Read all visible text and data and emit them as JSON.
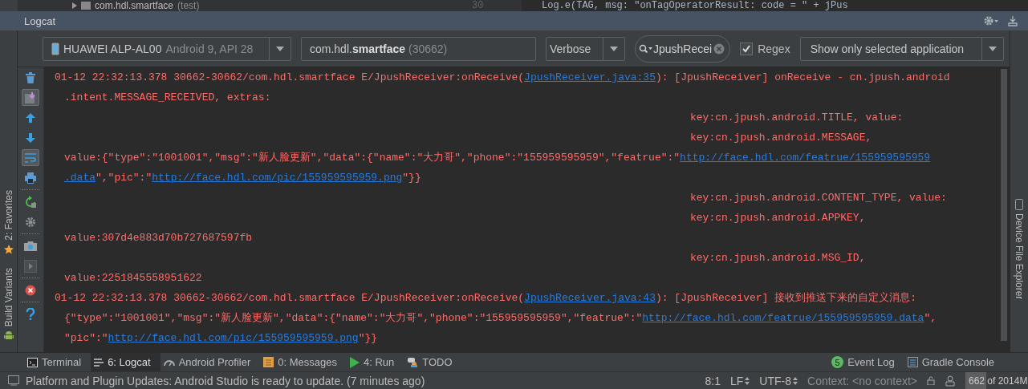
{
  "editor": {
    "project_node": "com.hdl.smartface",
    "project_suffix": "(test)",
    "line_number": "30",
    "code": "Log.e(TAG, msg: \"onTagOperatorResult: code = \" + jPus"
  },
  "logcat": {
    "title": "Logcat",
    "device": {
      "name": "HUAWEI ALP-AL00",
      "detail": "Android 9, API 28"
    },
    "process": {
      "prefix": "com.hdl.",
      "bold": "smartface",
      "pid": "(30662)"
    },
    "level": "Verbose",
    "search": {
      "value": "JpushRecei"
    },
    "regex": {
      "label": "Regex",
      "checked": true
    },
    "filter": "Show only selected application",
    "tools": [
      {
        "kind": "trash",
        "on": false
      },
      {
        "kind": "scroll-end",
        "on": true
      },
      {
        "kind": "up",
        "on": false
      },
      {
        "kind": "down",
        "on": false
      },
      {
        "kind": "wrap",
        "on": true
      },
      {
        "kind": "print",
        "on": false
      },
      {
        "kind": "restart",
        "on": false
      },
      {
        "kind": "gear",
        "on": false
      },
      {
        "kind": "camera",
        "on": false
      },
      {
        "kind": "video",
        "on": false
      },
      {
        "kind": "stop",
        "on": false
      },
      {
        "kind": "help",
        "on": false
      }
    ],
    "lines": [
      {
        "kind": "first",
        "segments": [
          {
            "text": "01-12 22:32:13.378 30662-30662/com.hdl.smartface E/JpushReceiver:onReceive(",
            "link": false
          },
          {
            "text": "JpushReceiver.java:35",
            "link": true
          },
          {
            "text": "): [JpushReceiver] onReceive - cn.jpush.android",
            "link": false
          }
        ]
      },
      {
        "kind": "cont",
        "segments": [
          {
            "text": ".intent.MESSAGE_RECEIVED, extras:",
            "link": false
          }
        ]
      },
      {
        "kind": "key",
        "segments": [
          {
            "text": "key:cn.jpush.android.TITLE, value:",
            "link": false
          }
        ]
      },
      {
        "kind": "key",
        "segments": [
          {
            "text": "key:cn.jpush.android.MESSAGE,",
            "link": false
          }
        ]
      },
      {
        "kind": "cont",
        "segments": [
          {
            "text": "value:{\"type\":\"1001001\",\"msg\":\"新人脸更新\",\"data\":{\"name\":\"大力哥\",\"phone\":\"155959595959\",\"featrue\":\"",
            "link": false
          },
          {
            "text": "http://face.hdl.com/featrue/155959595959",
            "link": true
          }
        ]
      },
      {
        "kind": "cont",
        "segments": [
          {
            "text": ".data",
            "link": true
          },
          {
            "text": "\",\"pic\":\"",
            "link": false
          },
          {
            "text": "http://face.hdl.com/pic/155959595959.png",
            "link": true
          },
          {
            "text": "\"}}",
            "link": false
          }
        ]
      },
      {
        "kind": "key",
        "segments": [
          {
            "text": "key:cn.jpush.android.CONTENT_TYPE, value:",
            "link": false
          }
        ]
      },
      {
        "kind": "key",
        "segments": [
          {
            "text": "key:cn.jpush.android.APPKEY,",
            "link": false
          }
        ]
      },
      {
        "kind": "cont",
        "segments": [
          {
            "text": "value:307d4e883d70b727687597fb",
            "link": false
          }
        ]
      },
      {
        "kind": "key",
        "segments": [
          {
            "text": "key:cn.jpush.android.MSG_ID,",
            "link": false
          }
        ]
      },
      {
        "kind": "cont",
        "segments": [
          {
            "text": "value:2251845558951622",
            "link": false
          }
        ]
      },
      {
        "kind": "first",
        "segments": [
          {
            "text": "01-12 22:32:13.378 30662-30662/com.hdl.smartface E/JpushReceiver:onReceive(",
            "link": false
          },
          {
            "text": "JpushReceiver.java:43",
            "link": true
          },
          {
            "text": "): [JpushReceiver] 接收到推送下来的自定义消息:",
            "link": false
          }
        ]
      },
      {
        "kind": "cont",
        "segments": [
          {
            "text": "{\"type\":\"1001001\",\"msg\":\"新人脸更新\",\"data\":{\"name\":\"大力哥\",\"phone\":\"155959595959\",\"featrue\":\"",
            "link": false
          },
          {
            "text": "http://face.hdl.com/featrue/155959595959.data",
            "link": true
          },
          {
            "text": "\",",
            "link": false
          }
        ]
      },
      {
        "kind": "cont",
        "segments": [
          {
            "text": "\"pic\":\"",
            "link": false
          },
          {
            "text": "http://face.hdl.com/pic/155959595959.png",
            "link": true
          },
          {
            "text": "\"}}",
            "link": false
          }
        ]
      }
    ]
  },
  "left_strip": [
    {
      "label": "2: Favorites",
      "kind": "star"
    },
    {
      "label": "Build Variants",
      "kind": "android"
    }
  ],
  "right_strip": [
    {
      "label": "Device File Explorer"
    }
  ],
  "bottom_tabs": [
    {
      "label": "Terminal",
      "kind": "terminal",
      "selected": false
    },
    {
      "label": "6: Logcat",
      "kind": "logcat",
      "selected": true
    },
    {
      "label": "Android Profiler",
      "kind": "profiler",
      "selected": false
    },
    {
      "label": "0: Messages",
      "kind": "messages",
      "selected": false
    },
    {
      "label": "4: Run",
      "kind": "run",
      "selected": false
    },
    {
      "label": "TODO",
      "kind": "todo",
      "selected": false
    }
  ],
  "bottom_right_tabs": [
    {
      "label": "Event Log",
      "badge": "5",
      "kind": "event"
    },
    {
      "label": "Gradle Console",
      "kind": "gradle"
    }
  ],
  "status_bar": {
    "message": "Platform and Plugin Updates: Android Studio is ready to update. (7 minutes ago)",
    "position": "8:1",
    "line_separator": "LF",
    "encoding": "UTF-8",
    "context": "Context: <no context>",
    "memory": {
      "used": "662",
      "rest": "of 2014M",
      "level": 0.33
    }
  }
}
